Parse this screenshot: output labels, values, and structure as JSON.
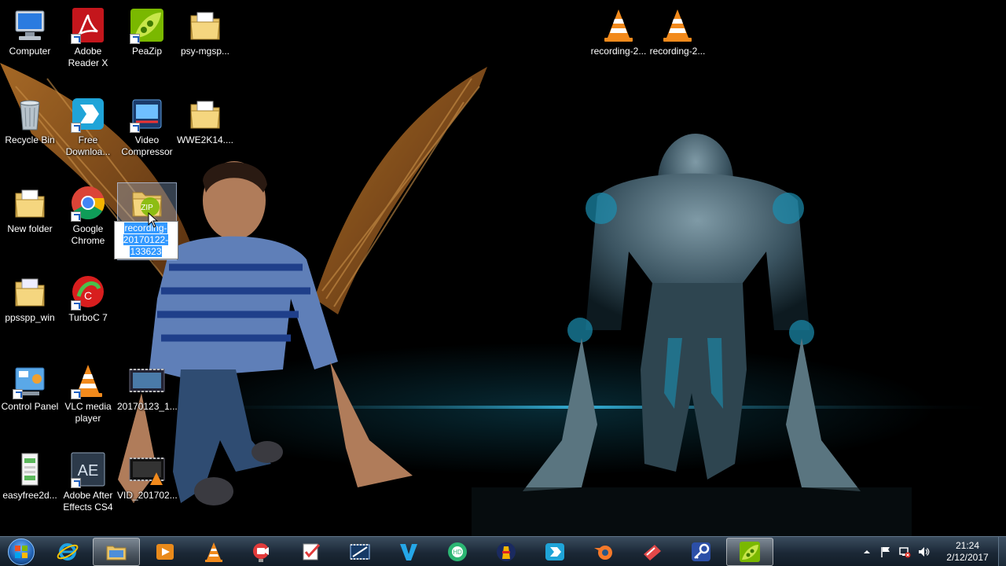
{
  "desktop": {
    "icons": [
      {
        "label": "Computer"
      },
      {
        "label": "Adobe Reader X"
      },
      {
        "label": "PeaZip"
      },
      {
        "label": "psy-mgsp..."
      },
      {
        "label": "Recycle Bin"
      },
      {
        "label": "Free Downloa..."
      },
      {
        "label": "Video Compressor"
      },
      {
        "label": "WWE2K14...."
      },
      {
        "label": "New folder"
      },
      {
        "label": "Google Chrome"
      },
      {
        "label": "recording-20170122-133623",
        "badge": "ZIP"
      },
      {
        "label": "ppsspp_win"
      },
      {
        "label": "TurboC 7"
      },
      {
        "label": "Control Panel"
      },
      {
        "label": "VLC media player"
      },
      {
        "label": "20170123_1..."
      },
      {
        "label": "easyfree2d..."
      },
      {
        "label": "Adobe After Effects CS4",
        "badge": "AE"
      },
      {
        "label": "VID_201702..."
      },
      {
        "label": "recording-2..."
      },
      {
        "label": "recording-2..."
      }
    ]
  },
  "taskbar": {
    "start_icon": "windows-orb-icon",
    "pinned": [
      "internet-explorer-icon",
      "file-explorer-icon",
      "media-player-icon",
      "vlc-icon",
      "screen-recorder-icon",
      "checklist-app-icon",
      "video-editor-icon",
      "vegas-v-icon",
      "camera-hd-icon",
      "lighthouse-app-icon",
      "free-downloader-icon",
      "blender-icon",
      "pdf-app-icon",
      "key-app-icon",
      "peazip-icon"
    ],
    "active_index": 14
  },
  "tray": {
    "time": "21:24",
    "date": "2/12/2017"
  },
  "colors": {
    "selection": "#3399ff",
    "taskbar": "#1b2836",
    "vlc_orange": "#f28a1c"
  }
}
